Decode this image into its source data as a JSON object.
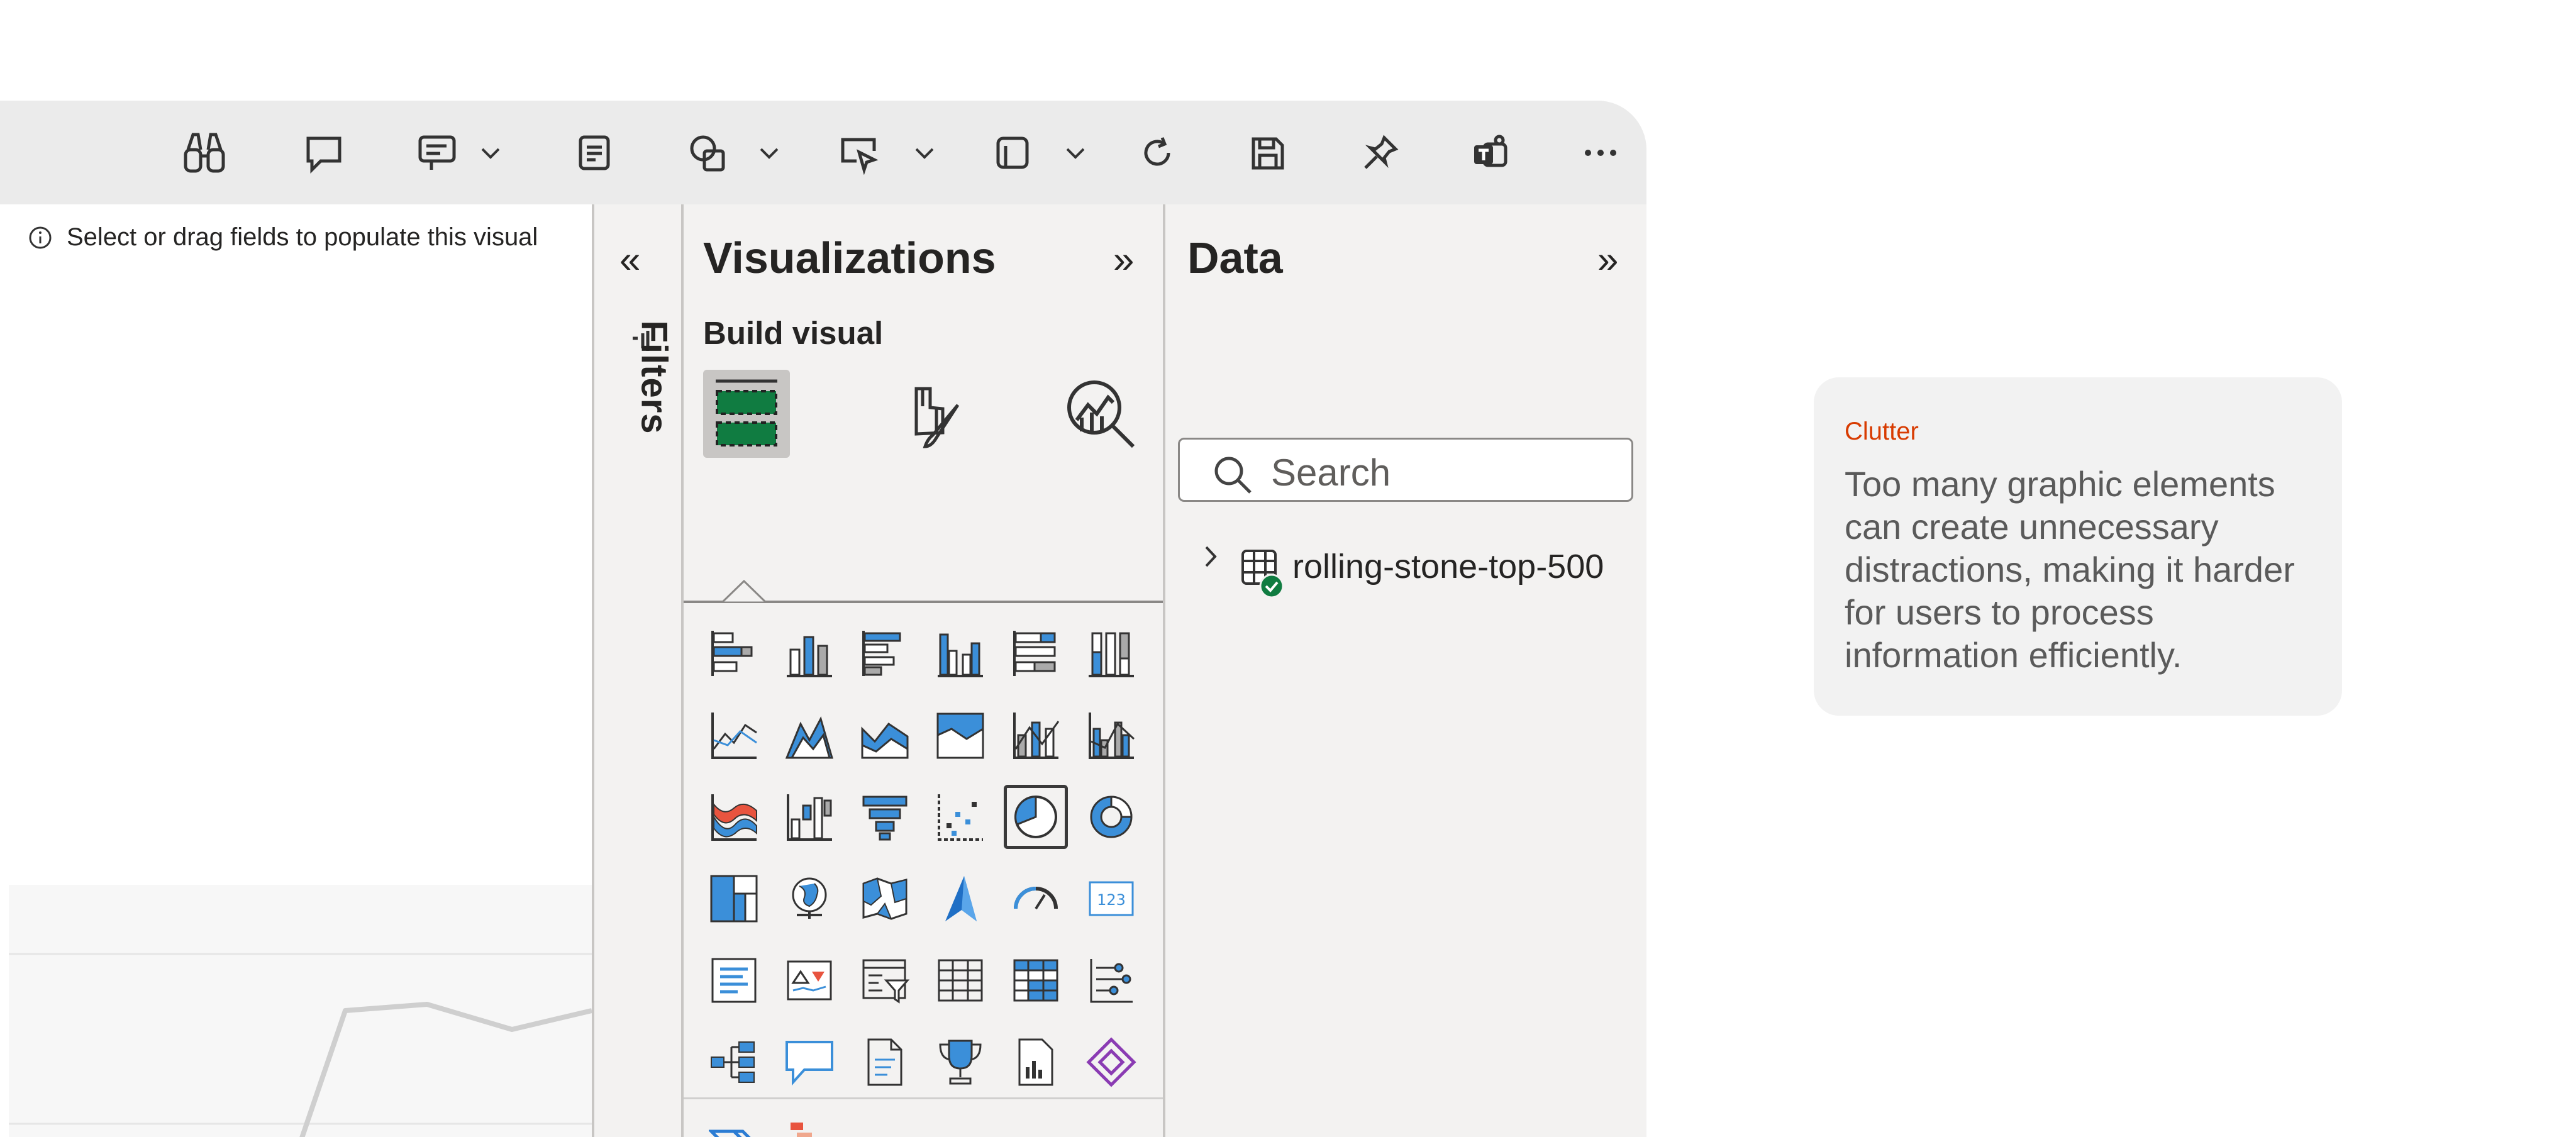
{
  "toolbar": {
    "icons": [
      "binoculars-icon",
      "comment-icon",
      "smart-narrative-icon",
      "chevron-down-icon",
      "notes-icon",
      "shapes-icon",
      "chevron-down-icon",
      "button-icon",
      "chevron-down-icon",
      "page-icon",
      "chevron-down-icon",
      "refresh-icon",
      "save-icon",
      "pin-icon",
      "teams-icon",
      "more-icon"
    ]
  },
  "canvas": {
    "hint": "Select or drag fields to populate this visual"
  },
  "filters": {
    "label": "Filters",
    "collapse_glyph": "«"
  },
  "visualizations": {
    "title": "Visualizations",
    "expand_glyph": "»",
    "build_visual_label": "Build visual",
    "tabs": [
      "build-visual-tab",
      "format-visual-tab",
      "analytics-tab"
    ],
    "more_label": "···",
    "visual_types": [
      "stacked-bar",
      "stacked-column",
      "clustered-bar",
      "clustered-column",
      "100-stacked-bar",
      "100-stacked-column",
      "line",
      "area",
      "stacked-area",
      "100-stacked-area",
      "line-stacked-column",
      "line-clustered-column",
      "ribbon",
      "waterfall",
      "funnel",
      "scatter",
      "pie",
      "donut",
      "treemap",
      "map",
      "filled-map",
      "azure-map",
      "gauge",
      "card",
      "multi-row-card",
      "kpi",
      "slicer",
      "table",
      "matrix",
      "key-influencers",
      "decomposition-tree",
      "qa",
      "smart-narrative",
      "metrics",
      "paginated-report",
      "power-apps",
      "power-automate",
      "custom-visual"
    ]
  },
  "data_pane": {
    "title": "Data",
    "expand_glyph": "»",
    "search_placeholder": "Search",
    "tables": [
      {
        "name": "rolling-stone-top-500"
      }
    ]
  },
  "tooltip": {
    "heading": "Clutter",
    "body": "Too many graphic elements can create unnecessary distractions, making it harder for users to process information efficiently."
  },
  "colors": {
    "accent_blue": "#3b8fd9",
    "accent_green": "#107c41",
    "tooltip_heading": "#d83b01"
  }
}
